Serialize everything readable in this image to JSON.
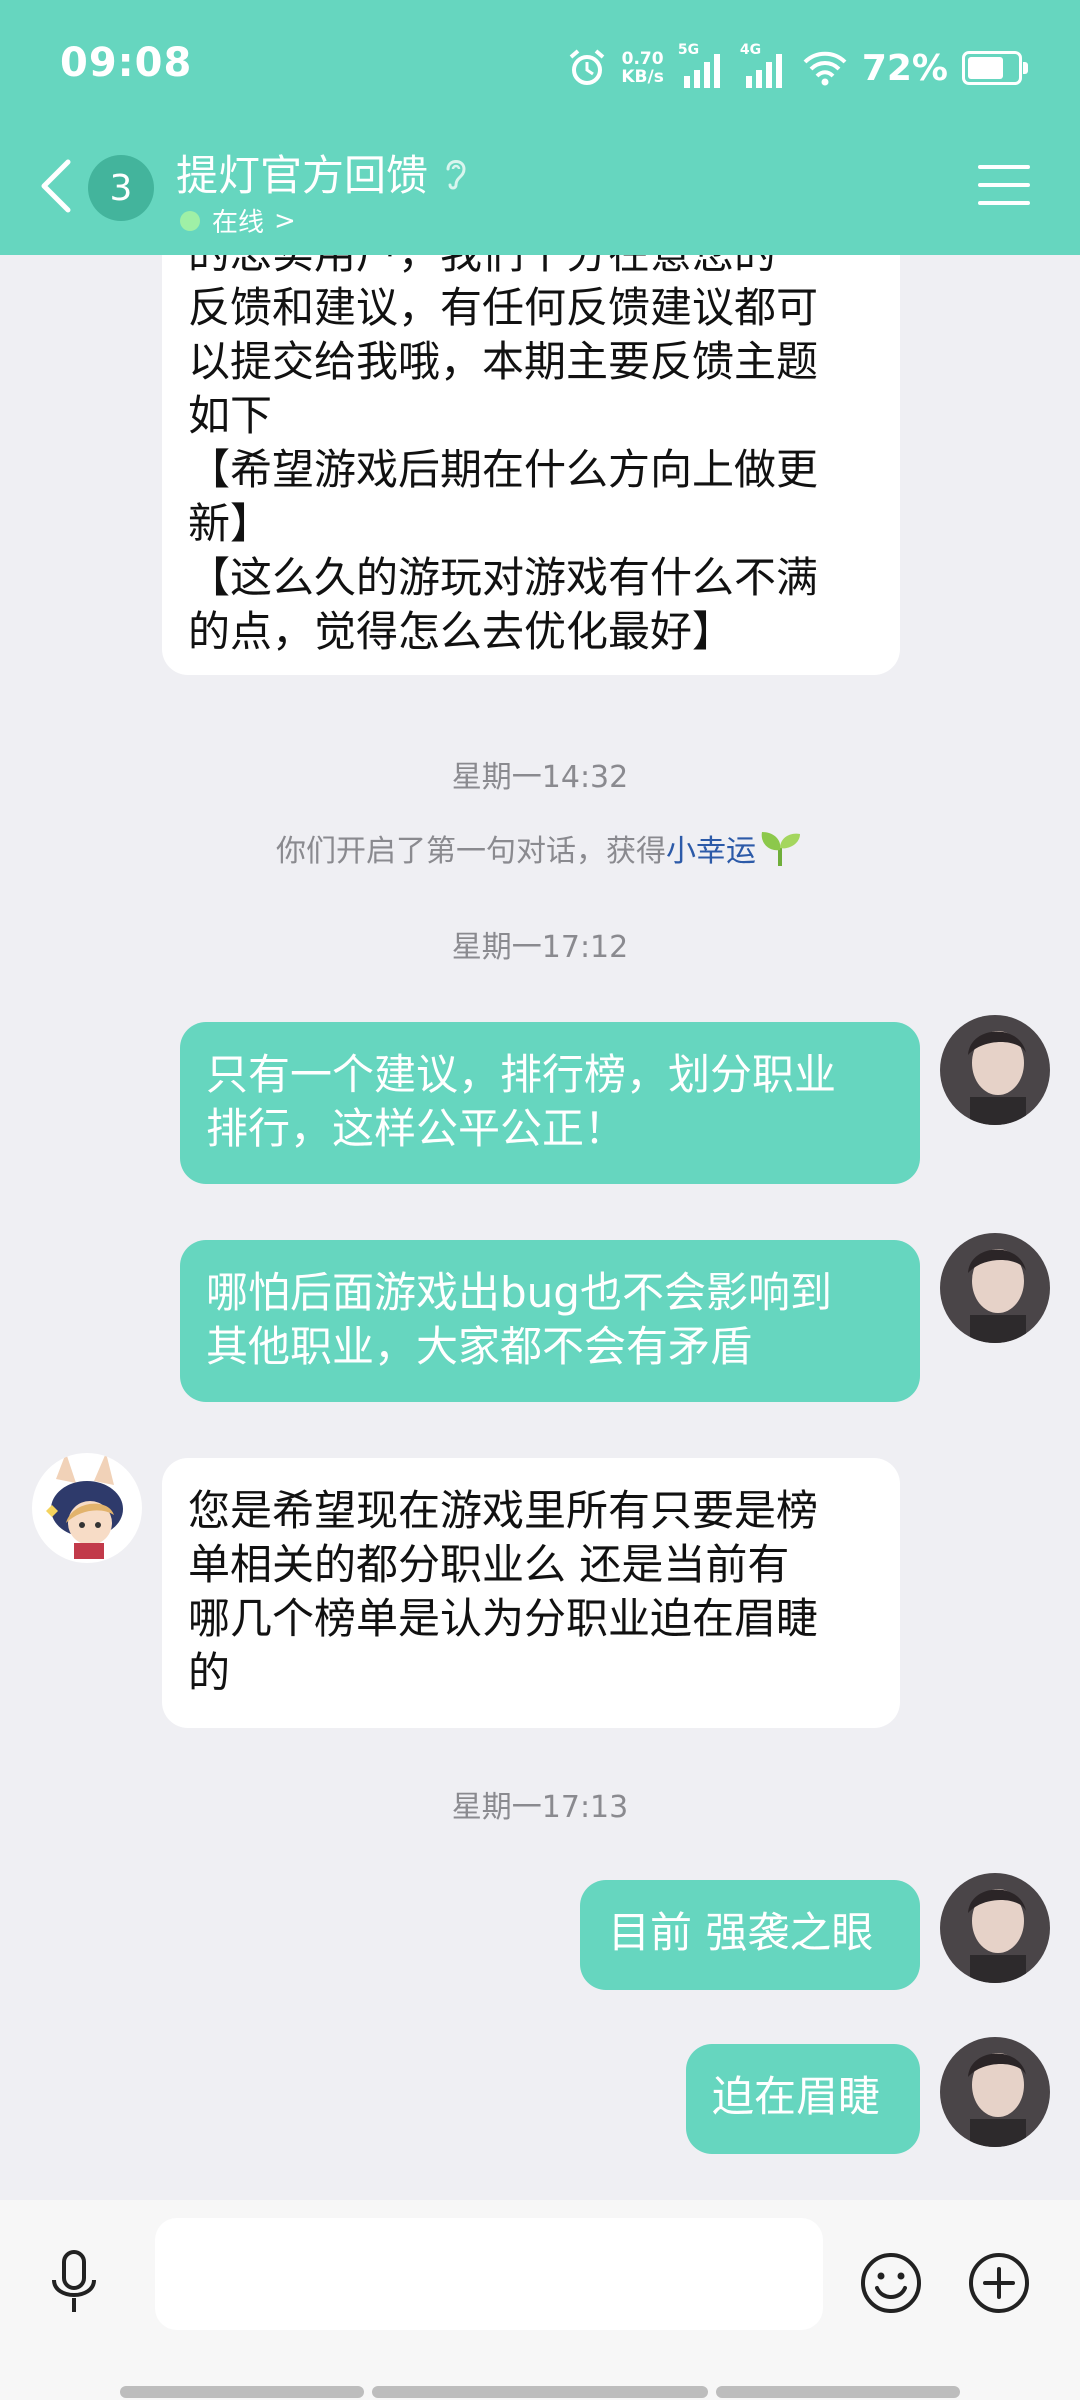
{
  "status_bar": {
    "time": "09:08",
    "net_speed_value": "0.70",
    "net_speed_unit": "KB/s",
    "signal1_label": "5G",
    "signal2_label": "4G",
    "battery_pct": "72%"
  },
  "header": {
    "unread_count": "3",
    "title": "提灯官方回馈",
    "status": "在线",
    "chevron": ">"
  },
  "messages": {
    "m1": {
      "line0": "的忠实用户，我们十分在意您的",
      "line1": "反馈和建议，有任何反馈建议都可",
      "line2": "以提交给我哦，本期主要反馈主题",
      "line3": "如下",
      "line4": "【希望游戏后期在什么方向上做更",
      "line5": "新】",
      "line6": "【这么久的游玩对游戏有什么不满",
      "line7": "的点，觉得怎么去优化最好】"
    },
    "ts1": "星期一14:32",
    "sys_note_prefix": "你们开启了第一句对话，获得",
    "sys_note_link": "小幸运",
    "ts2": "星期一17:12",
    "m2": {
      "line0": "只有一个建议，排行榜，划分职业",
      "line1": "排行，这样公平公正！"
    },
    "m3": {
      "line0": "哪怕后面游戏出bug也不会影响到",
      "line1": "其他职业，大家都不会有矛盾"
    },
    "m4": {
      "line0": "您是希望现在游戏里所有只要是榜",
      "line1": "单相关的都分职业么 还是当前有",
      "line2": "哪几个榜单是认为分职业迫在眉睫",
      "line3": "的"
    },
    "ts3": "星期一17:13",
    "m5": "目前 强袭之眼",
    "m6": "迫在眉睫"
  },
  "input": {
    "placeholder": ""
  },
  "colors": {
    "accent": "#66d6bf",
    "background": "#efeff3",
    "incoming_bubble": "#ffffff",
    "link": "#2c5aa8"
  },
  "icons": [
    "back-icon",
    "ear-icon",
    "menu-icon",
    "sprout-icon",
    "mic-icon",
    "emoji-icon",
    "plus-icon"
  ]
}
